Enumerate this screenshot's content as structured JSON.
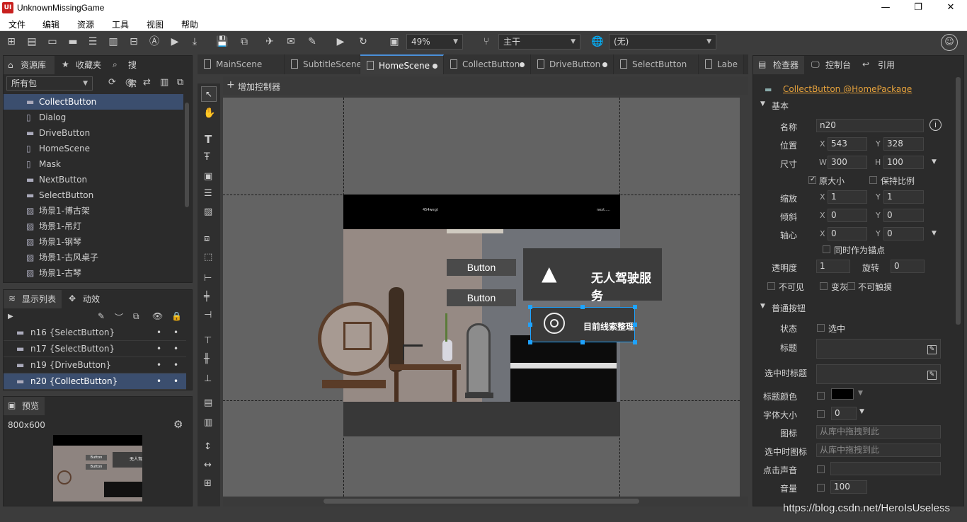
{
  "window": {
    "title": "UnknownMissingGame",
    "app_icon_text": "UI",
    "minimize": "—",
    "restore": "❐",
    "close": "✕"
  },
  "menu": [
    "文件",
    "编辑",
    "资源",
    "工具",
    "视图",
    "帮助"
  ],
  "toolbar": {
    "zoom": "49%",
    "branch": "主干",
    "language": "(无)"
  },
  "library": {
    "tabs": [
      "资源库",
      "收藏夹",
      "搜索"
    ],
    "package_filter": "所有包",
    "items": [
      {
        "label": "CollectButton",
        "icon": "component-icon",
        "selected": true
      },
      {
        "label": "Dialog",
        "icon": "document-icon"
      },
      {
        "label": "DriveButton",
        "icon": "component-icon"
      },
      {
        "label": "HomeScene",
        "icon": "document-icon"
      },
      {
        "label": "Mask",
        "icon": "document-icon"
      },
      {
        "label": "NextButton",
        "icon": "component-icon"
      },
      {
        "label": "SelectButton",
        "icon": "component-icon"
      },
      {
        "label": "场景1-博古架",
        "icon": "image-icon"
      },
      {
        "label": "场景1-吊灯",
        "icon": "image-icon"
      },
      {
        "label": "场景1-钢琴",
        "icon": "image-icon"
      },
      {
        "label": "场景1-古风桌子",
        "icon": "image-icon"
      },
      {
        "label": "场景1-古琴",
        "icon": "image-icon"
      }
    ]
  },
  "display_list": {
    "tabs": [
      "显示列表",
      "动效"
    ],
    "rows": [
      {
        "label": "n16 {SelectButton}"
      },
      {
        "label": "n17 {SelectButton}"
      },
      {
        "label": "n19 {DriveButton}"
      },
      {
        "label": "n20 {CollectButton}",
        "selected": true
      }
    ],
    "bullet": "•"
  },
  "preview": {
    "tab": "预览",
    "size": "800x600",
    "btn1": "Button",
    "btn2": "Button",
    "side_text": "无人驾"
  },
  "editor": {
    "tabs": [
      {
        "label": "MainScene",
        "modified": false
      },
      {
        "label": "SubtitleScene",
        "modified": false
      },
      {
        "label": "HomeScene",
        "modified": true,
        "active": true
      },
      {
        "label": "CollectButton",
        "modified": true
      },
      {
        "label": "DriveButton",
        "modified": true
      },
      {
        "label": "SelectButton",
        "modified": false
      },
      {
        "label": "Labe",
        "modified": false
      }
    ],
    "add_controller": "增加控制器"
  },
  "stage": {
    "header_left": "454wegt",
    "header_right": "next.....",
    "button1": "Button",
    "button2": "Button",
    "drive_service": "无人驾驶服务",
    "collect_label": "目前线索整理"
  },
  "inspector": {
    "tabs": [
      "检查器",
      "控制台",
      "引用"
    ],
    "link": "CollectButton @HomePackage",
    "basic_section": "基本",
    "name_label": "名称",
    "name_value": "n20",
    "position_label": "位置",
    "x": "543",
    "y": "328",
    "size_label": "尺寸",
    "w": "300",
    "h": "100",
    "original_size": "原大小",
    "keep_ratio": "保持比例",
    "scale_label": "缩放",
    "scale_x": "1",
    "scale_y": "1",
    "skew_label": "倾斜",
    "skew_x": "0",
    "skew_y": "0",
    "pivot_label": "轴心",
    "pivot_x": "0",
    "pivot_y": "0",
    "also_anchor": "同时作为锚点",
    "alpha_label": "透明度",
    "alpha": "1",
    "rotation_label": "旋转",
    "rotation": "0",
    "invisible": "不可见",
    "grayed": "变灰",
    "untouchable": "不可触摸",
    "button_section": "普通按钮",
    "state_label": "状态",
    "selected_text": "选中",
    "title_label": "标题",
    "selected_title_label": "选中时标题",
    "title_color_label": "标题颜色",
    "font_size_label": "字体大小",
    "font_size": "0",
    "icon_label": "图标",
    "icon_placeholder": "从库中拖拽到此",
    "selected_icon_label": "选中时图标",
    "selected_icon_placeholder": "从库中拖拽到此",
    "click_sound_label": "点击声音",
    "volume_label": "音量",
    "volume": "100"
  },
  "watermark": "https://blog.csdn.net/HeroIsUseless",
  "colors": {
    "accent": "#4a90d9",
    "selection": "#3b4e6e",
    "handle": "#1ea3ff",
    "link": "#e6a23c"
  }
}
